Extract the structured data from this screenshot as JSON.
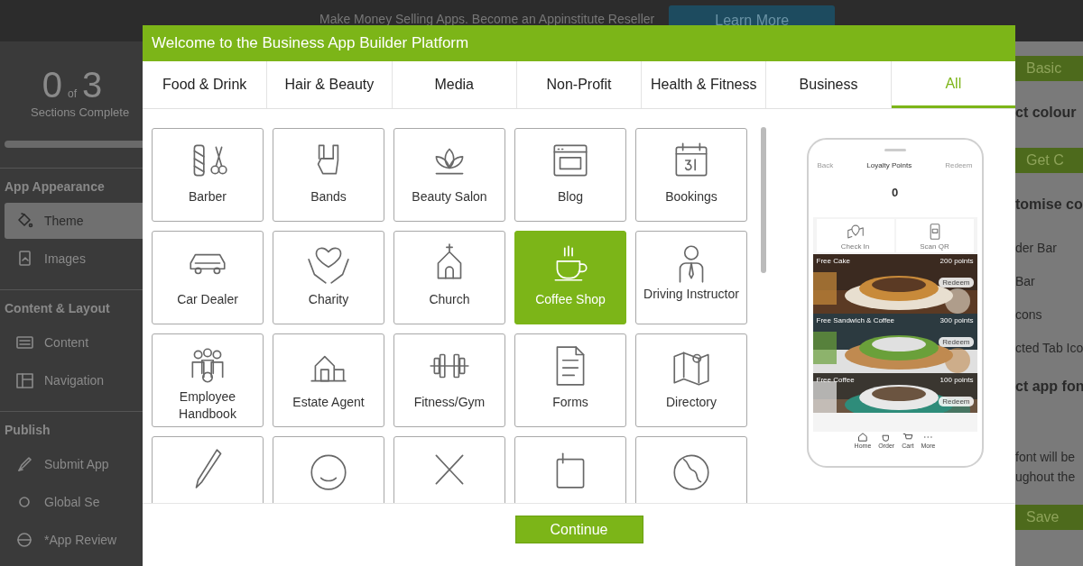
{
  "banner": {
    "message": "Make Money Selling Apps. Become an Appinstitute Reseller",
    "button": "Learn More"
  },
  "sidebar": {
    "progress": {
      "done": "0",
      "of": "of",
      "total": "3",
      "caption": "Sections Complete",
      "level": 0
    },
    "sections": [
      {
        "title": "App Appearance",
        "items": [
          {
            "label": "Theme",
            "selected": true
          },
          {
            "label": "Images",
            "selected": false
          }
        ]
      },
      {
        "title": "Content & Layout",
        "items": [
          {
            "label": "Content",
            "selected": false
          },
          {
            "label": "Navigation",
            "selected": false
          }
        ]
      },
      {
        "title": "Publish",
        "items": [
          {
            "label": "Submit App",
            "selected": false
          },
          {
            "label": "Global Se",
            "selected": false
          },
          {
            "label": "*App Review",
            "selected": false
          }
        ]
      }
    ]
  },
  "right_panel": {
    "items": [
      {
        "kind": "button",
        "text": "Basic"
      },
      {
        "kind": "heading",
        "text": "ct colour"
      },
      {
        "kind": "button",
        "text": "Get C"
      },
      {
        "kind": "heading",
        "text": "tomise co"
      },
      {
        "kind": "option",
        "text": "der Bar"
      },
      {
        "kind": "option",
        "text": "Bar"
      },
      {
        "kind": "option",
        "text": "cons"
      },
      {
        "kind": "option",
        "text": "cted Tab Ico"
      },
      {
        "kind": "heading",
        "text": "ct app fon"
      },
      {
        "kind": "text",
        "text": "font will be"
      },
      {
        "kind": "text",
        "text": "ughout the"
      },
      {
        "kind": "button",
        "text": "Save"
      }
    ]
  },
  "modal": {
    "title": "Welcome to the Business App Builder Platform",
    "tabs": [
      {
        "label": "Food & Drink",
        "selected": false
      },
      {
        "label": "Hair & Beauty",
        "selected": false
      },
      {
        "label": "Media",
        "selected": false
      },
      {
        "label": "Non-Profit",
        "selected": false
      },
      {
        "label": "Health & Fitness",
        "selected": false
      },
      {
        "label": "Business",
        "selected": false
      },
      {
        "label": "All",
        "selected": true
      }
    ],
    "templates": [
      {
        "label": "Barber",
        "selected": false
      },
      {
        "label": "Bands",
        "selected": false
      },
      {
        "label": "Beauty Salon",
        "selected": false
      },
      {
        "label": "Blog",
        "selected": false
      },
      {
        "label": "Bookings",
        "selected": false
      },
      {
        "label": "Car Dealer",
        "selected": false
      },
      {
        "label": "Charity",
        "selected": false
      },
      {
        "label": "Church",
        "selected": false
      },
      {
        "label": "Coffee Shop",
        "selected": true
      },
      {
        "label": "Driving Instructor",
        "selected": false
      },
      {
        "label": "Employee Handbook",
        "selected": false
      },
      {
        "label": "Estate Agent",
        "selected": false
      },
      {
        "label": "Fitness/Gym",
        "selected": false
      },
      {
        "label": "Forms",
        "selected": false
      },
      {
        "label": "Directory",
        "selected": false
      },
      {
        "selected": false
      },
      {
        "selected": false
      },
      {
        "selected": false
      },
      {
        "selected": false
      },
      {
        "selected": false
      }
    ],
    "preview": {
      "back": "Back",
      "title": "Loyalty Points",
      "action": "Redeem",
      "points": "0",
      "actions": [
        "Check In",
        "Scan QR"
      ],
      "rewards": [
        {
          "name": "Free Cake",
          "points": "200 points",
          "button": "Redeem"
        },
        {
          "name": "Free Sandwich & Coffee",
          "points": "300 points",
          "button": "Redeem"
        },
        {
          "name": "Free Coffee",
          "points": "100 points",
          "button": "Redeem"
        }
      ],
      "nav": [
        "Home",
        "Order",
        "Cart",
        "More"
      ]
    },
    "continue_button": "Continue"
  }
}
